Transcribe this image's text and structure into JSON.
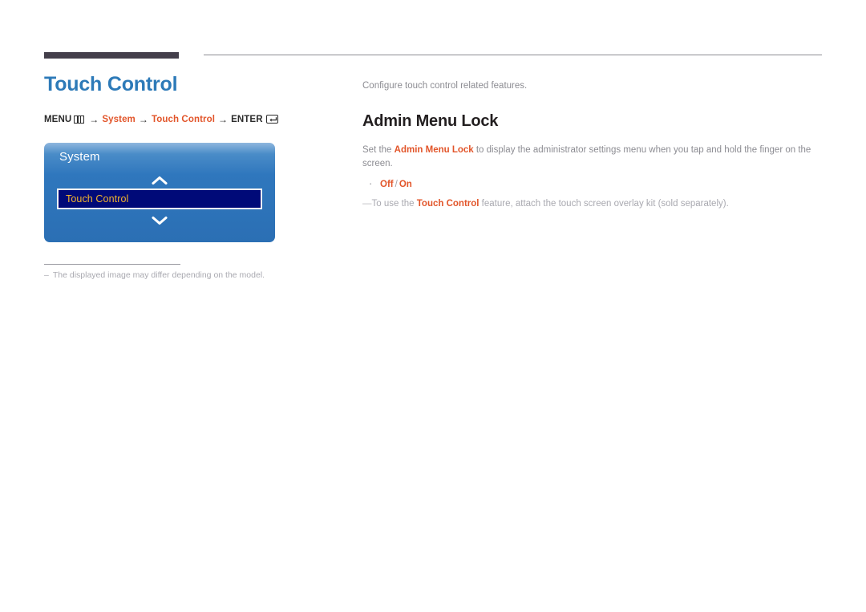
{
  "header": {
    "rule_dark_name": "header-accent-bar",
    "rule_thin_name": "header-rule"
  },
  "left": {
    "page_title": "Touch Control",
    "breadcrumb": {
      "menu_label": "MENU",
      "menu_icon": "menu-grid-icon",
      "arrow": "→",
      "step_system": "System",
      "step_touch_control": "Touch Control",
      "enter_label": "ENTER",
      "enter_icon": "enter-return-icon"
    },
    "osd": {
      "title": "System",
      "scroll_up_icon": "chevron-up-icon",
      "scroll_down_icon": "chevron-down-icon",
      "selected_item": "Touch Control",
      "panel_color": "#2f77bd",
      "selected_bg_color": "#000a78",
      "selected_text_color": "#f3b52c"
    },
    "footnote": {
      "dash": "–",
      "text": "The displayed image may differ depending on the model."
    }
  },
  "right": {
    "intro": "Configure touch control related features.",
    "section_heading": "Admin Menu Lock",
    "description": {
      "before": "Set the ",
      "accent": "Admin Menu Lock",
      "after": " to display the administrator settings menu when you tap and hold the finger on the screen."
    },
    "options": {
      "bullet": "·",
      "off": "Off",
      "separator": "/",
      "on": "On"
    },
    "note": {
      "emdash": "―",
      "before": "To use the ",
      "accent": "Touch Control",
      "after": " feature, attach the touch screen overlay kit (sold separately)."
    }
  },
  "colors": {
    "title_blue": "#2d7ab8",
    "accent_orange": "#e2552a",
    "heading_dark": "#231f20",
    "body_gray": "#8c8c92"
  }
}
